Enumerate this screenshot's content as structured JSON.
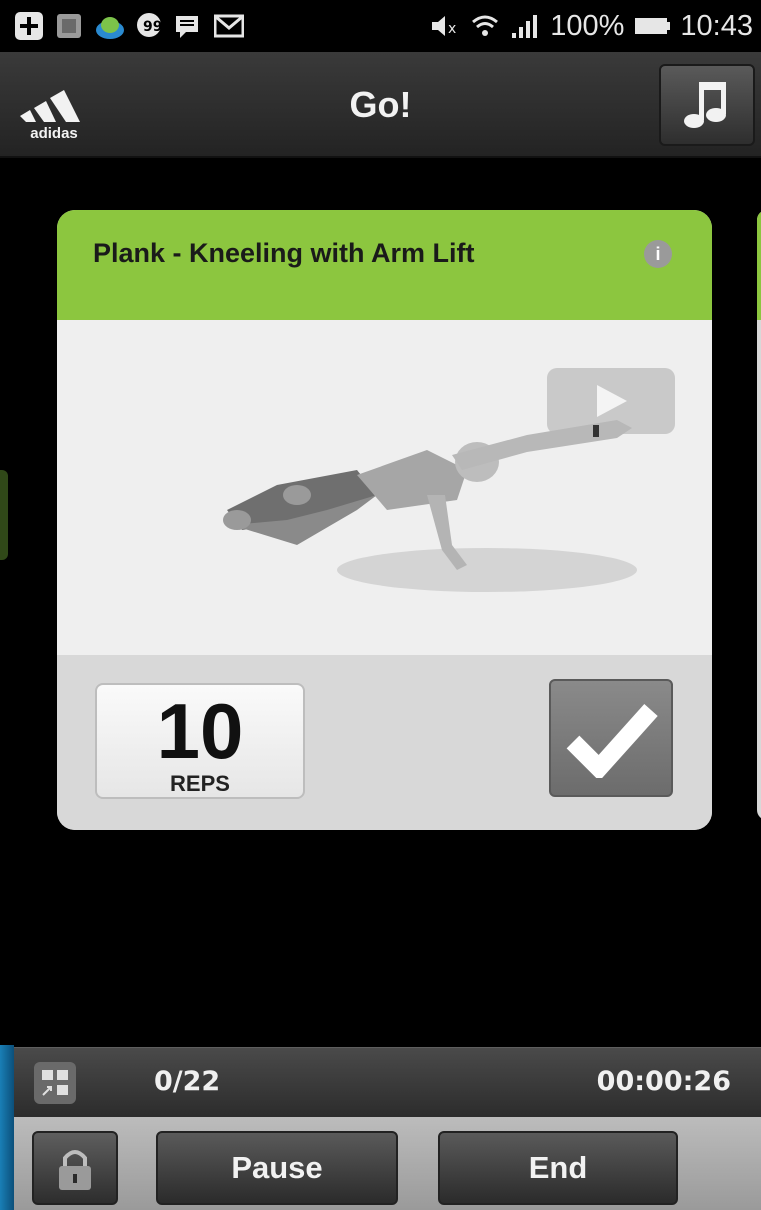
{
  "status_bar": {
    "battery": "100%",
    "time": "10:43",
    "icons": [
      "plus-icon",
      "screen-icon",
      "cloud-icon",
      "hangouts-icon",
      "chat-icon",
      "gmail-icon",
      "mute-icon",
      "wifi-icon",
      "signal-icon",
      "battery-icon"
    ]
  },
  "header": {
    "title": "Go!",
    "logo": "adidas"
  },
  "exercise": {
    "title": "Plank - Kneeling with Arm Lift",
    "reps": "10",
    "reps_label": "REPS"
  },
  "progress": {
    "count": "0/22",
    "elapsed": "00:00:26"
  },
  "controls": {
    "pause_label": "Pause",
    "end_label": "End"
  },
  "colors": {
    "accent_green": "#8cc63f",
    "background": "#000000"
  }
}
